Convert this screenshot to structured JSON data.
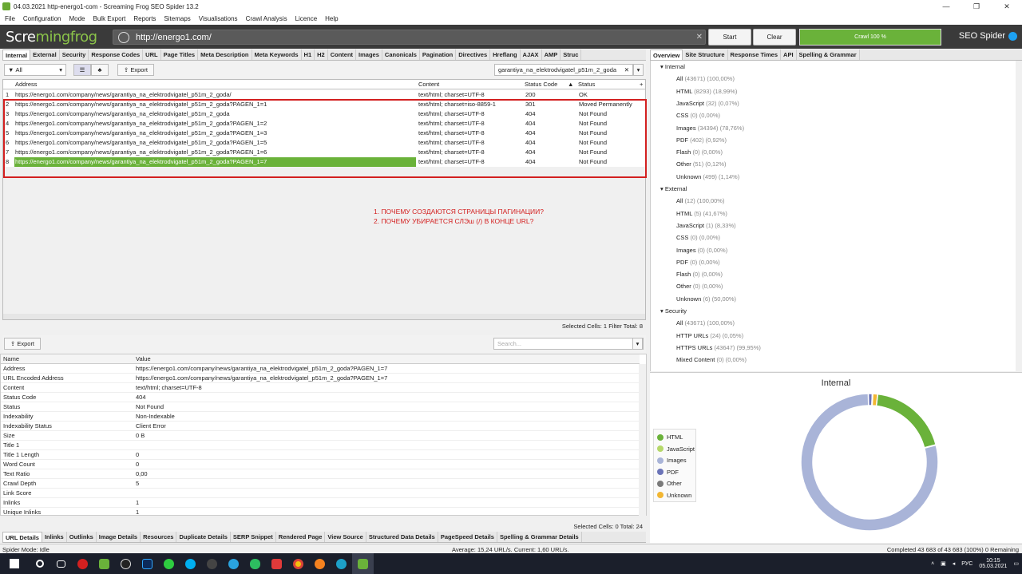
{
  "window": {
    "title": "04.03.2021 http-energo1-com - Screaming Frog SEO Spider 13.2",
    "min": "—",
    "max": "❐",
    "close": "✕"
  },
  "menu": [
    "File",
    "Configuration",
    "Mode",
    "Bulk Export",
    "Reports",
    "Sitemaps",
    "Visualisations",
    "Crawl Analysis",
    "Licence",
    "Help"
  ],
  "topbar": {
    "logo_a": "Scre",
    "logo_b": "ming",
    "logo_c": "frog",
    "url": "http://energo1.com/",
    "start": "Start",
    "clear": "Clear",
    "progress": "Crawl 100 %",
    "progress_value": 1.0,
    "brand": "SEO Spider"
  },
  "left_tabs": [
    "Internal",
    "External",
    "Security",
    "Response Codes",
    "URL",
    "Page Titles",
    "Meta Description",
    "Meta Keywords",
    "H1",
    "H2",
    "Content",
    "Images",
    "Canonicals",
    "Pagination",
    "Directives",
    "Hreflang",
    "AJAX",
    "AMP",
    "Struc"
  ],
  "filter": {
    "value": "All",
    "export": "Export",
    "search_value": "garantiya_na_elektrodvigatel_p51m_2_goda"
  },
  "grid": {
    "headers": {
      "address": "Address",
      "content": "Content",
      "status_code": "Status Code",
      "status": "Status"
    },
    "rows": [
      {
        "n": "1",
        "address": "https://energo1.com/company/news/garantiya_na_elektrodvigatel_p51m_2_goda/",
        "content": "text/html; charset=UTF-8",
        "code": "200",
        "status": "OK"
      },
      {
        "n": "2",
        "address": "https://energo1.com/company/news/garantiya_na_elektrodvigatel_p51m_2_goda?PAGEN_1=1",
        "content": "text/html; charset=iso-8859-1",
        "code": "301",
        "status": "Moved Permanently"
      },
      {
        "n": "3",
        "address": "https://energo1.com/company/news/garantiya_na_elektrodvigatel_p51m_2_goda",
        "content": "text/html; charset=UTF-8",
        "code": "404",
        "status": "Not Found"
      },
      {
        "n": "4",
        "address": "https://energo1.com/company/news/garantiya_na_elektrodvigatel_p51m_2_goda?PAGEN_1=2",
        "content": "text/html; charset=UTF-8",
        "code": "404",
        "status": "Not Found"
      },
      {
        "n": "5",
        "address": "https://energo1.com/company/news/garantiya_na_elektrodvigatel_p51m_2_goda?PAGEN_1=3",
        "content": "text/html; charset=UTF-8",
        "code": "404",
        "status": "Not Found"
      },
      {
        "n": "6",
        "address": "https://energo1.com/company/news/garantiya_na_elektrodvigatel_p51m_2_goda?PAGEN_1=5",
        "content": "text/html; charset=UTF-8",
        "code": "404",
        "status": "Not Found"
      },
      {
        "n": "7",
        "address": "https://energo1.com/company/news/garantiya_na_elektrodvigatel_p51m_2_goda?PAGEN_1=6",
        "content": "text/html; charset=UTF-8",
        "code": "404",
        "status": "Not Found"
      },
      {
        "n": "8",
        "address": "https://energo1.com/company/news/garantiya_na_elektrodvigatel_p51m_2_goda?PAGEN_1=7",
        "content": "text/html; charset=UTF-8",
        "code": "404",
        "status": "Not Found"
      }
    ]
  },
  "note": {
    "line1": "1. ПОЧЕМУ СОЗДАЮТСЯ СТРАНИЦЫ ПАГИНАЦИИ?",
    "line2": "2. ПОЧЕМУ УБИРАЕТСЯ СЛЭш (/) В КОНЦЕ URL?"
  },
  "status_top": "Selected Cells: 1  Filter Total: 8",
  "lower": {
    "export": "Export",
    "search_placeholder": "Search...",
    "headers": {
      "name": "Name",
      "value": "Value"
    },
    "rows": [
      {
        "name": "Address",
        "value": "https://energo1.com/company/news/garantiya_na_elektrodvigatel_p51m_2_goda?PAGEN_1=7"
      },
      {
        "name": "URL Encoded Address",
        "value": "https://energo1.com/company/news/garantiya_na_elektrodvigatel_p51m_2_goda?PAGEN_1=7"
      },
      {
        "name": "Content",
        "value": "text/html; charset=UTF-8"
      },
      {
        "name": "Status Code",
        "value": "404"
      },
      {
        "name": "Status",
        "value": "Not Found"
      },
      {
        "name": "Indexability",
        "value": "Non-Indexable"
      },
      {
        "name": "Indexability Status",
        "value": "Client Error"
      },
      {
        "name": "Size",
        "value": "0 B"
      },
      {
        "name": "Title 1",
        "value": ""
      },
      {
        "name": "Title 1 Length",
        "value": "0"
      },
      {
        "name": "Word Count",
        "value": "0"
      },
      {
        "name": "Text Ratio",
        "value": "0,00"
      },
      {
        "name": "Crawl Depth",
        "value": "5"
      },
      {
        "name": "Link Score",
        "value": ""
      },
      {
        "name": "Inlinks",
        "value": "1"
      },
      {
        "name": "Unique Inlinks",
        "value": "1"
      }
    ],
    "status": "Selected Cells: 0  Total: 24"
  },
  "bottom_tabs": [
    "URL Details",
    "Inlinks",
    "Outlinks",
    "Image Details",
    "Resources",
    "Duplicate Details",
    "SERP Snippet",
    "Rendered Page",
    "View Source",
    "Structured Data Details",
    "PageSpeed Details",
    "Spelling & Grammar Details"
  ],
  "right_tabs": [
    "Overview",
    "Site Structure",
    "Response Times",
    "API",
    "Spelling & Grammar"
  ],
  "overview": [
    {
      "section": "Internal",
      "items": [
        [
          "All",
          "(43671) (100,00%)"
        ],
        [
          "HTML",
          "(8293) (18,99%)"
        ],
        [
          "JavaScript",
          "(32) (0,07%)"
        ],
        [
          "CSS",
          "(0) (0,00%)"
        ],
        [
          "Images",
          "(34394) (78,76%)"
        ],
        [
          "PDF",
          "(402) (0,92%)"
        ],
        [
          "Flash",
          "(0) (0,00%)"
        ],
        [
          "Other",
          "(51) (0,12%)"
        ],
        [
          "Unknown",
          "(499) (1,14%)"
        ]
      ]
    },
    {
      "section": "External",
      "items": [
        [
          "All",
          "(12) (100,00%)"
        ],
        [
          "HTML",
          "(5) (41,67%)"
        ],
        [
          "JavaScript",
          "(1) (8,33%)"
        ],
        [
          "CSS",
          "(0) (0,00%)"
        ],
        [
          "Images",
          "(0) (0,00%)"
        ],
        [
          "PDF",
          "(0) (0,00%)"
        ],
        [
          "Flash",
          "(0) (0,00%)"
        ],
        [
          "Other",
          "(0) (0,00%)"
        ],
        [
          "Unknown",
          "(6) (50,00%)"
        ]
      ]
    },
    {
      "section": "Security",
      "items": [
        [
          "All",
          "(43671) (100,00%)"
        ],
        [
          "HTTP URLs",
          "(24) (0,05%)"
        ],
        [
          "HTTPS URLs",
          "(43647) (99,95%)"
        ],
        [
          "Mixed Content",
          "(0) (0,00%)"
        ]
      ]
    }
  ],
  "chart_data": {
    "type": "pie",
    "title": "Internal",
    "categories": [
      "HTML",
      "JavaScript",
      "Images",
      "PDF",
      "Other",
      "Unknown"
    ],
    "values": [
      8293,
      32,
      34394,
      402,
      51,
      499
    ],
    "colors": [
      "#6ab23a",
      "#b5d86a",
      "#a9b4d8",
      "#6b74b8",
      "#7a7a7a",
      "#f2b632"
    ]
  },
  "spider_mode": "Spider Mode: Idle",
  "average": "Average: 15,24 URL/s. Current: 1,60 URL/s.",
  "completed": "Completed 43 683 of 43 683 (100%) 0 Remaining",
  "tray": {
    "lang": "РУС",
    "time": "10:15",
    "date": "05.03.2021"
  }
}
